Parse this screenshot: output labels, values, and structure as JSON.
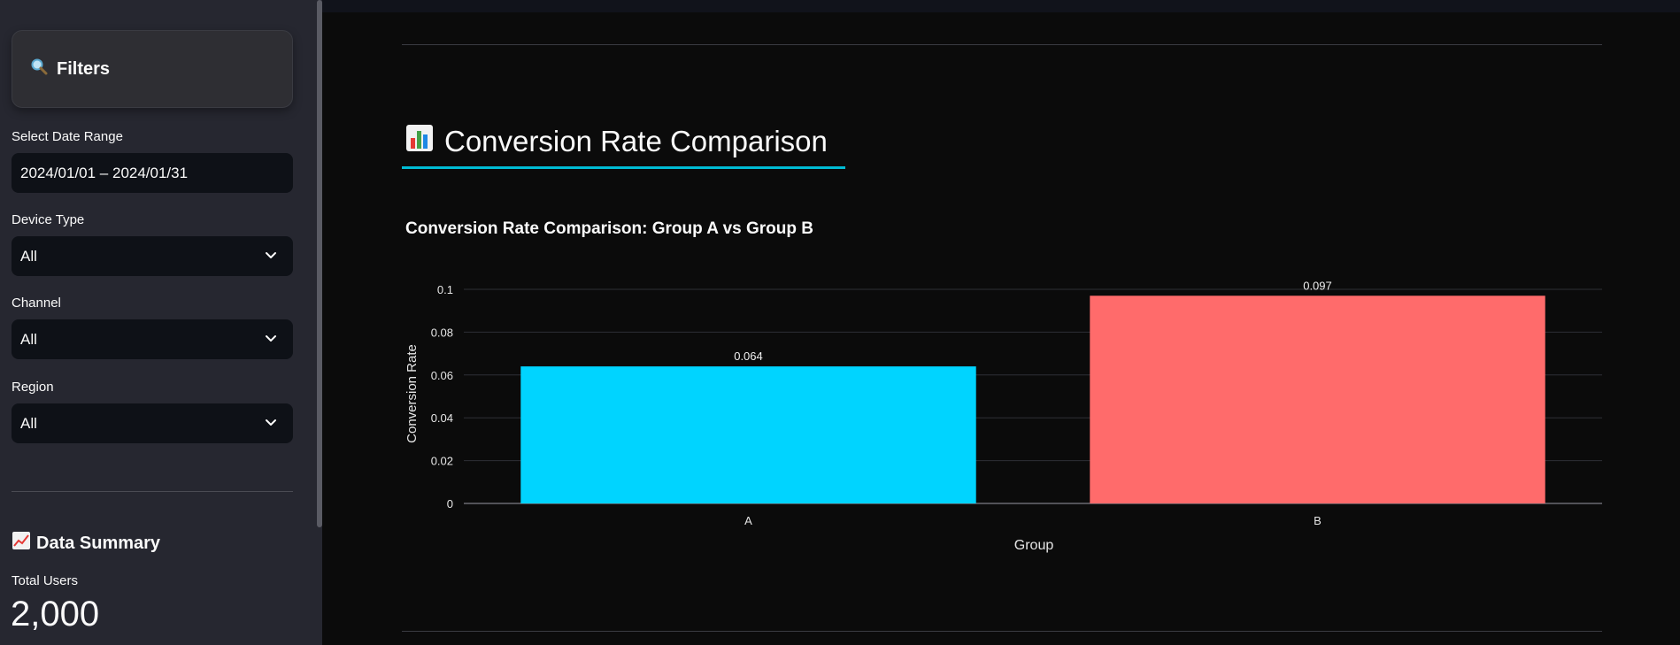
{
  "sidebar": {
    "filters_title": "Filters",
    "filters_icon": "magnifier-icon",
    "date_range": {
      "label": "Select Date Range",
      "value": "2024/01/01 – 2024/01/31"
    },
    "device_type": {
      "label": "Device Type",
      "value": "All"
    },
    "channel": {
      "label": "Channel",
      "value": "All"
    },
    "region": {
      "label": "Region",
      "value": "All"
    },
    "summary_title": "Data Summary",
    "summary_icon": "chart-increasing-icon",
    "total_users_label": "Total Users",
    "total_users_value": "2,000"
  },
  "main": {
    "section_title": "Conversion Rate Comparison",
    "section_icon": "bar-chart-icon",
    "accent_color": "#00bcd4"
  },
  "chart_data": {
    "type": "bar",
    "title": "Conversion Rate Comparison: Group A vs Group B",
    "xlabel": "Group",
    "ylabel": "Conversion Rate",
    "categories": [
      "A",
      "B"
    ],
    "values": [
      0.064,
      0.097
    ],
    "value_labels": [
      "0.064",
      "0.097"
    ],
    "colors": [
      "#00d4ff",
      "#ff6b6b"
    ],
    "ylim": [
      0,
      0.1
    ],
    "yticks": [
      0,
      0.02,
      0.04,
      0.06,
      0.08,
      0.1
    ],
    "ytick_labels": [
      "0",
      "0.02",
      "0.04",
      "0.06",
      "0.08",
      "0.1"
    ],
    "grid": true
  }
}
